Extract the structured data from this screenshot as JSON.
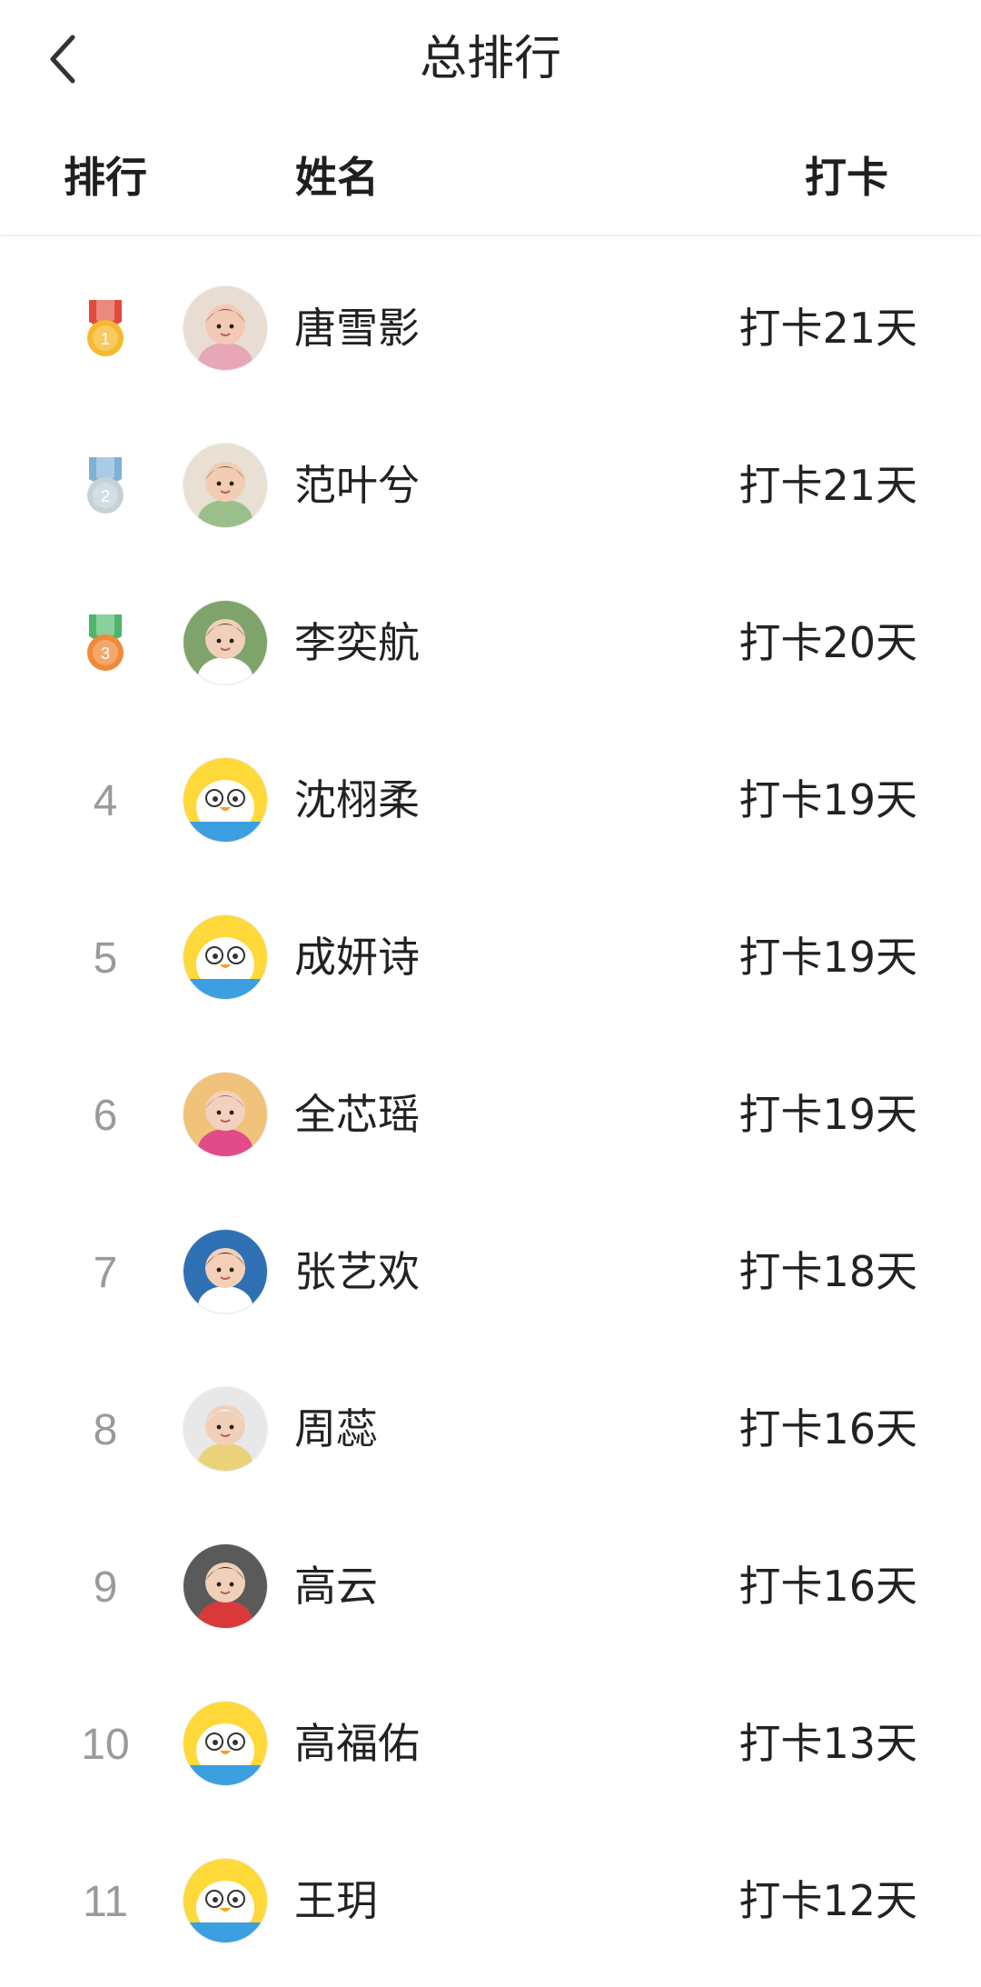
{
  "topbar": {
    "title": "总排行"
  },
  "header": {
    "rank": "排行",
    "name": "姓名",
    "checkin": "打卡"
  },
  "colors": {
    "gold": "#f5b82e",
    "silver": "#c5d3d8",
    "bronze": "#f08a3a",
    "ribbon_red": "#e24b3b",
    "ribbon_blue": "#7fb0d6",
    "ribbon_green": "#4db56b",
    "duck_yellow": "#ffd83a",
    "duck_blue": "#3b9fe0"
  },
  "rows": [
    {
      "rank": "1",
      "medal": "gold",
      "medal_label": "1",
      "avatar": "photo-girl-pink",
      "name": "唐雪影",
      "checkin": "打卡21天"
    },
    {
      "rank": "2",
      "medal": "silver",
      "medal_label": "2",
      "avatar": "photo-baby-bed",
      "name": "范叶兮",
      "checkin": "打卡21天"
    },
    {
      "rank": "3",
      "medal": "bronze",
      "medal_label": "3",
      "avatar": "photo-boy-outdoor",
      "name": "李奕航",
      "checkin": "打卡20天"
    },
    {
      "rank": "4",
      "medal": null,
      "avatar": "duck-default",
      "name": "沈栩柔",
      "checkin": "打卡19天"
    },
    {
      "rank": "5",
      "medal": null,
      "avatar": "duck-default",
      "name": "成妍诗",
      "checkin": "打卡19天"
    },
    {
      "rank": "6",
      "medal": null,
      "avatar": "photo-child-play",
      "name": "全芯瑶",
      "checkin": "打卡19天"
    },
    {
      "rank": "7",
      "medal": null,
      "avatar": "photo-child-blue-bg",
      "name": "张艺欢",
      "checkin": "打卡18天"
    },
    {
      "rank": "8",
      "medal": null,
      "avatar": "photo-child-white-hat",
      "name": "周蕊",
      "checkin": "打卡16天"
    },
    {
      "rank": "9",
      "medal": null,
      "avatar": "photo-child-red",
      "name": "高云",
      "checkin": "打卡16天"
    },
    {
      "rank": "10",
      "medal": null,
      "avatar": "duck-default",
      "name": "高福佑",
      "checkin": "打卡13天"
    },
    {
      "rank": "11",
      "medal": null,
      "avatar": "duck-default",
      "name": "王玥",
      "checkin": "打卡12天"
    }
  ]
}
